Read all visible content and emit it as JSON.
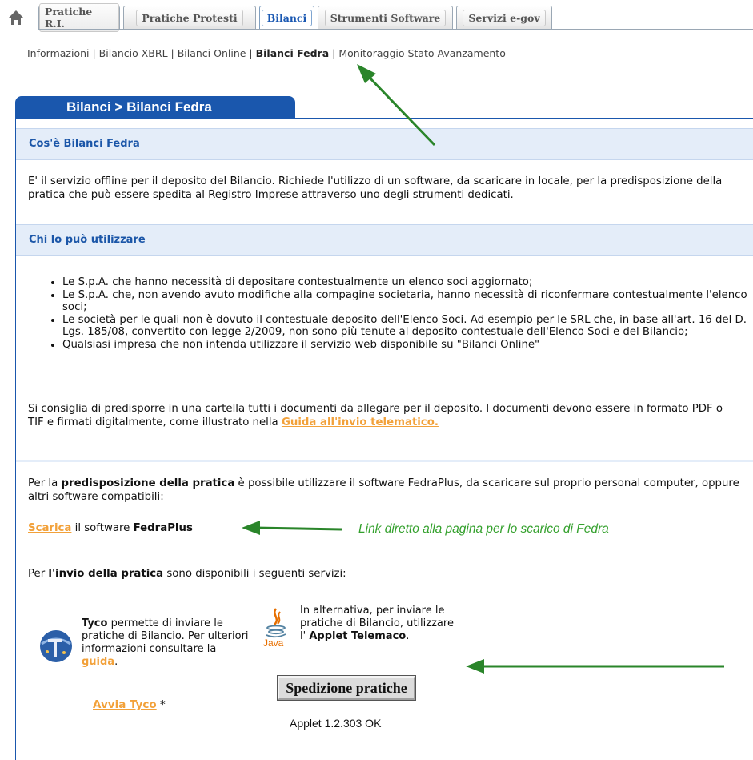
{
  "tabs": [
    {
      "label": "Pratiche R.I.",
      "active": false
    },
    {
      "label": "Pratiche Protesti",
      "active": false
    },
    {
      "label": "Bilanci",
      "active": true
    },
    {
      "label": "Strumenti Software",
      "active": false
    },
    {
      "label": "Servizi e-gov",
      "active": false
    }
  ],
  "subnav": {
    "items": [
      "Informazioni",
      "Bilancio XBRL",
      "Bilanci Online",
      "Bilanci Fedra",
      "Monitoraggio Stato Avanzamento"
    ],
    "separator": " | ",
    "current": "Bilanci Fedra"
  },
  "header": {
    "title": "Bilanci > Bilanci Fedra"
  },
  "section1": {
    "heading": "Cos'è Bilanci Fedra",
    "text": "E' il servizio offline per il deposito del Bilancio. Richiede l'utilizzo di un software, da scaricare in locale, per la predisposizione della pratica che può essere spedita al Registro Imprese attraverso uno degli strumenti dedicati."
  },
  "section2": {
    "heading": "Chi lo può utilizzare",
    "bullets": [
      "Le S.p.A. che hanno necessità di depositare contestualmente un elenco soci aggiornato;",
      "Le S.p.A. che, non avendo avuto modifiche alla compagine societaria, hanno necessità di riconfermare contestualmente l'elenco soci;",
      "Le società per le quali non è dovuto il contestuale deposito dell'Elenco Soci. Ad esempio per le SRL che, in base all'art. 16 del D. Lgs. 185/08, convertito con legge 2/2009, non sono più tenute al deposito contestuale dell'Elenco Soci e del Bilancio;",
      "Qualsiasi impresa che non intenda utilizzare il servizio web disponibile su \"Bilanci Online\""
    ],
    "advice_text": "Si consiglia di predisporre in una cartella tutti i documenti da allegare per il deposito. I documenti devono essere in formato PDF o TIF e firmati digitalmente, come illustrato nella ",
    "advice_link": "Guida all'invio telematico."
  },
  "section3": {
    "intro_pre": "Per la ",
    "intro_bold": "predisposizione della pratica",
    "intro_post": " è possibile utilizzare il software FedraPlus, da scaricare sul proprio personal computer, oppure altri software compatibili:",
    "download_link": "Scarica",
    "download_mid": " il software ",
    "download_bold": "FedraPlus",
    "annotation": "Link diretto alla pagina per lo scarico di Fedra",
    "send_pre": "Per ",
    "send_bold": "l'invio della pratica",
    "send_post": " sono disponibili i seguenti servizi:"
  },
  "tyco": {
    "bold": "Tyco",
    "text": " permette di inviare le pratiche di Bilancio. Per ulteriori informazioni consultare la ",
    "link": "guida",
    "end": ".",
    "launch_link": "Avvia Tyco",
    "launch_suffix": " *"
  },
  "java": {
    "text": "In alternativa, per inviare le pratiche di Bilancio, utilizzare l' ",
    "bold": "Applet Telemaco",
    "end": ".",
    "icon_label": "Java",
    "button": "Spedizione pratiche",
    "status": "Applet 1.2.303 OK"
  },
  "colors": {
    "accent": "#1a57ad",
    "link": "#f2a13a",
    "annotation": "#33a02c",
    "section_bg": "#e4edf9"
  }
}
